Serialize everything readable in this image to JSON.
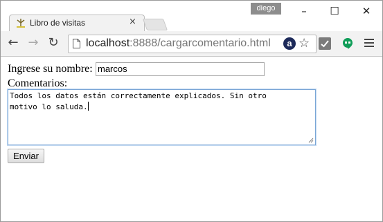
{
  "window": {
    "user": "diego",
    "controls": {
      "minimize": "–",
      "maximize": "☐",
      "close": "✕"
    }
  },
  "tab": {
    "title": "Libro de visitas",
    "favicon": "guestbook-favicon-icon",
    "close": "×"
  },
  "toolbar": {
    "back": "←",
    "forward": "→",
    "reload": "↻",
    "url_host": "localhost",
    "url_rest": ":8888/cargarcomentario.html",
    "bookmark": "☆",
    "extensions": [
      "amazon-assistant-icon",
      "check-extension-icon",
      "hangouts-icon"
    ],
    "ext_a_label": "a"
  },
  "form": {
    "name_label": "Ingrese su nombre:",
    "name_value": "marcos",
    "comments_label": "Comentarios:",
    "comments_value": "Todos los datos están correctamente explicados. Sin otro\nmotivo lo saluda.",
    "submit_label": "Enviar"
  }
}
